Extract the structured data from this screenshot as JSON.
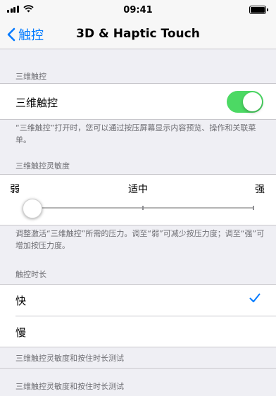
{
  "status_bar": {
    "time": "09:41"
  },
  "nav": {
    "back_label": "触控",
    "title": "3D & Haptic Touch"
  },
  "section_3d": {
    "header": "三维触控",
    "cell_label": "三维触控",
    "toggle_on": true,
    "footer": "“三维触控”打开时，您可以通过按压屏幕显示内容预览、操作和关联菜单。"
  },
  "sensitivity": {
    "header": "三维触控灵敏度",
    "label_left": "弱",
    "label_center": "适中",
    "label_right": "强",
    "value": 0,
    "footer": "调整激活“三维触控”所需的压力。调至“弱”可减少按压力度；调至“强”可增加按压力度。"
  },
  "duration": {
    "header": "触控时长",
    "options": [
      "快",
      "慢"
    ],
    "selected": "快"
  },
  "tests": {
    "row1": "三维触控灵敏度和按住时长测试",
    "row2": "三维触控灵敏度和按住时长测试"
  },
  "colors": {
    "accent": "#007aff",
    "toggle_on": "#4cd964",
    "background": "#efeff4"
  }
}
